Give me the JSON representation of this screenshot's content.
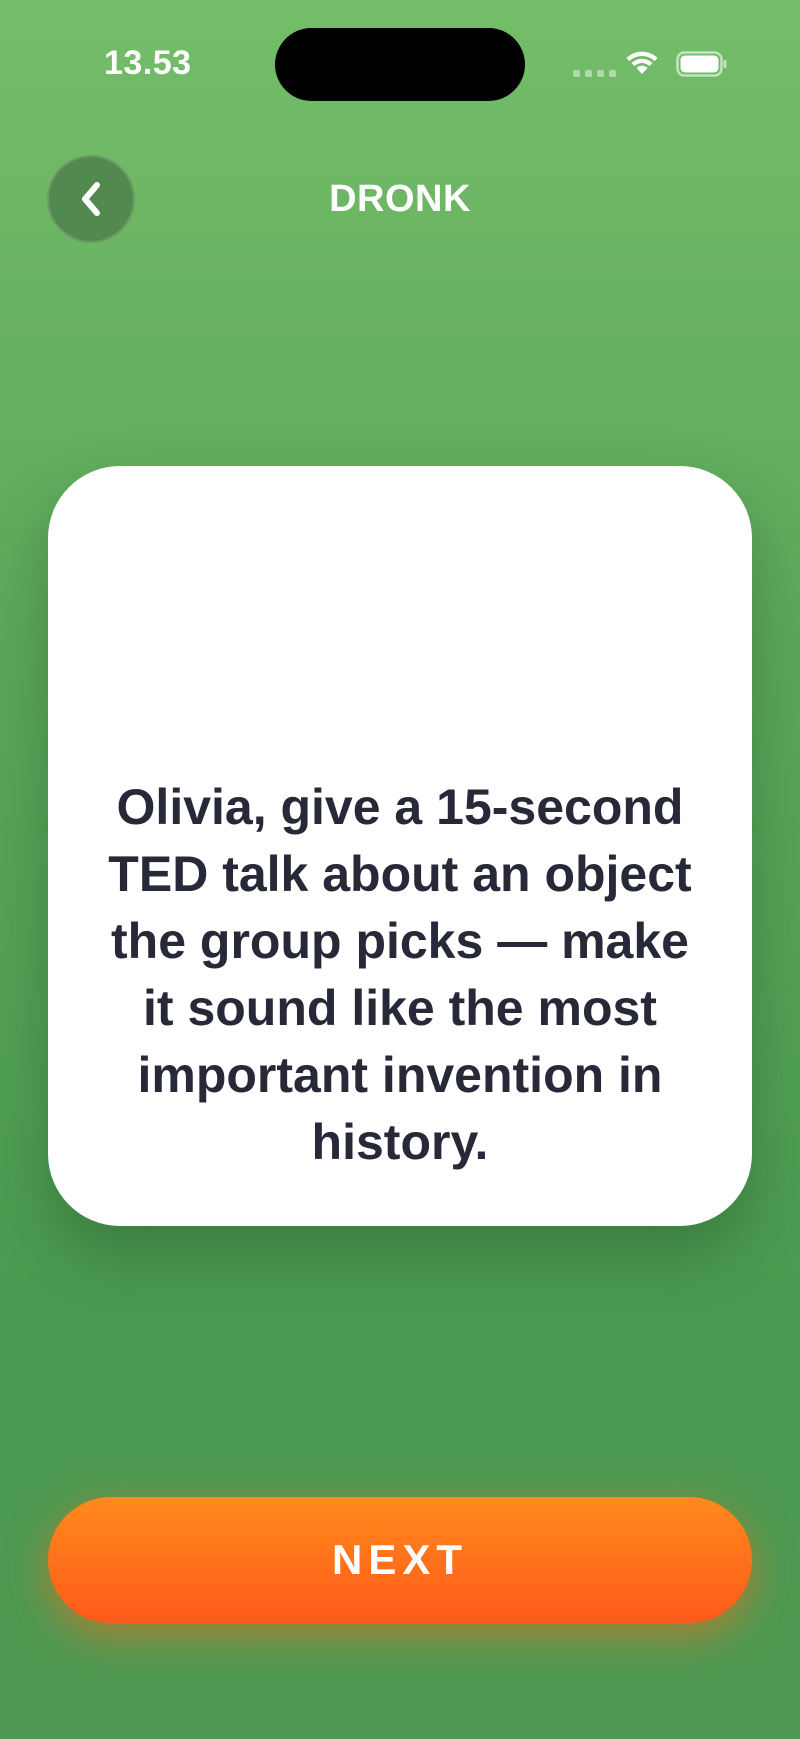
{
  "status_bar": {
    "time": "13.53",
    "icons": [
      "signal-dots-icon",
      "wifi-icon",
      "battery-icon"
    ]
  },
  "header": {
    "back_icon": "chevron-left-icon",
    "title": "DRONK"
  },
  "card": {
    "prompt": "Olivia, give a 15-second TED talk about an object the group picks — make it sound like the most important invention in history."
  },
  "actions": {
    "next_label": "NEXT"
  },
  "colors": {
    "background_top": "#74bd69",
    "background_bottom": "#4a9a51",
    "card_background": "#ffffff",
    "card_text": "#272838",
    "next_button_top": "#ff8a1c",
    "next_button_bottom": "#ff5a1a"
  }
}
